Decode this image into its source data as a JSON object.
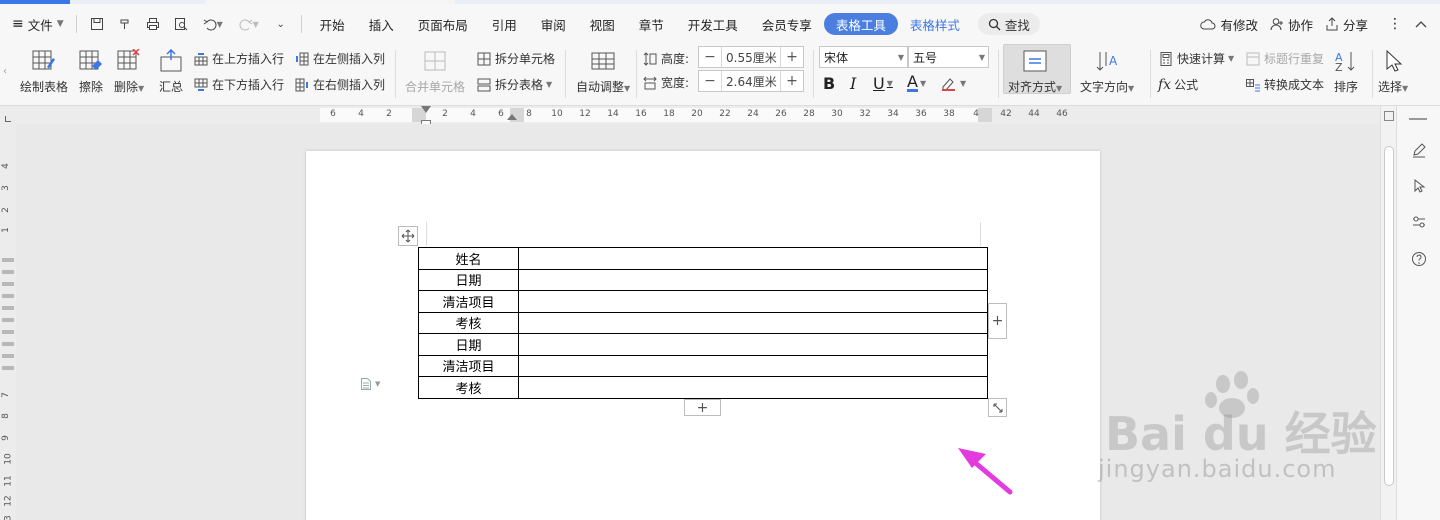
{
  "menubar": {
    "file_label": "文件",
    "tabs": [
      {
        "label": "开始"
      },
      {
        "label": "插入"
      },
      {
        "label": "页面布局"
      },
      {
        "label": "引用"
      },
      {
        "label": "审阅"
      },
      {
        "label": "视图"
      },
      {
        "label": "章节"
      },
      {
        "label": "开发工具"
      },
      {
        "label": "会员专享"
      },
      {
        "label": "表格工具"
      },
      {
        "label": "表格样式"
      }
    ],
    "search_label": "查找",
    "modified_label": "有修改",
    "collab_label": "协作",
    "share_label": "分享"
  },
  "ribbon": {
    "draw_table": "绘制表格",
    "erase": "擦除",
    "delete": "删除",
    "summary": "汇总",
    "insert_row_above": "在上方插入行",
    "insert_row_below": "在下方插入行",
    "insert_col_left": "在左侧插入列",
    "insert_col_right": "在右侧插入列",
    "merge_cells": "合并单元格",
    "split_cells": "拆分单元格",
    "split_table": "拆分表格",
    "auto_fit": "自动调整",
    "height_label": "高度:",
    "height_value": "0.55厘米",
    "width_label": "宽度:",
    "width_value": "2.64厘米",
    "font_name": "宋体",
    "font_size": "五号",
    "align": "对齐方式",
    "text_direction": "文字方向",
    "quick_calc": "快速计算",
    "repeat_header": "标题行重复",
    "formula": "公式",
    "to_text": "转换成文本",
    "sort": "排序",
    "select": "选择"
  },
  "ruler": {
    "labels": [
      "6",
      "4",
      "2",
      "2",
      "4",
      "6",
      "8",
      "10",
      "12",
      "14",
      "16",
      "18",
      "20",
      "22",
      "24",
      "26",
      "28",
      "30",
      "32",
      "34",
      "36",
      "38",
      "4",
      "42",
      "44",
      "46"
    ],
    "vlabels": [
      "4",
      "3",
      "2",
      "1",
      "7",
      "8",
      "9",
      "10",
      "11",
      "12",
      "13"
    ]
  },
  "table": {
    "rows": [
      {
        "label": "姓名",
        "value": ""
      },
      {
        "label": "日期",
        "value": ""
      },
      {
        "label": "清洁项目",
        "value": ""
      },
      {
        "label": "考核",
        "value": ""
      },
      {
        "label": "日期",
        "value": ""
      },
      {
        "label": "清洁项目",
        "value": ""
      },
      {
        "label": "考核",
        "value": ""
      }
    ]
  },
  "watermark": {
    "brand": "Bai du 经验",
    "url": "jingyan.baidu.com"
  },
  "colors": {
    "accent": "#4a7fe0",
    "arrow": "#e43be0"
  }
}
